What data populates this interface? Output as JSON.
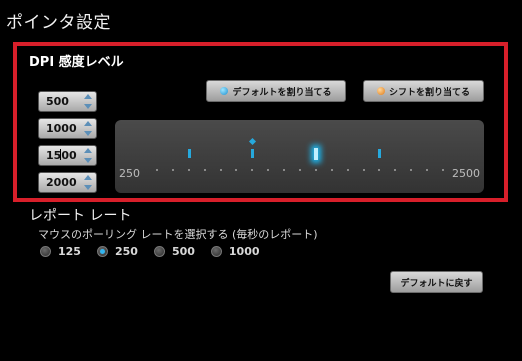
{
  "window": {
    "title": "ポインタ設定"
  },
  "dpi": {
    "heading": "DPI 感度レベル",
    "assign_default_label": "デフォルトを割り当てる",
    "assign_shift_label": "シフトを割り当てる",
    "levels": [
      "500",
      "1000",
      "1500",
      "2000"
    ],
    "slider": {
      "min_label": "250",
      "max_label": "2500",
      "min": 250,
      "max": 2500,
      "step": 125,
      "level_values": [
        500,
        1000,
        1500,
        2000
      ],
      "default_value": 1000,
      "shift_value": 1500
    },
    "colors": {
      "accent": "#26a9dd",
      "frame": "#d81f2a"
    }
  },
  "report_rate": {
    "heading": "レポート レート",
    "description": "マウスのポーリング レートを選択する (毎秒のレポート)",
    "options": [
      "125",
      "250",
      "500",
      "1000"
    ],
    "selected": "250"
  },
  "footer": {
    "restore_default_label": "デフォルトに戻す"
  },
  "icons": {
    "default_marker": "blue-dot-icon",
    "shift_marker": "orange-dot-icon"
  }
}
